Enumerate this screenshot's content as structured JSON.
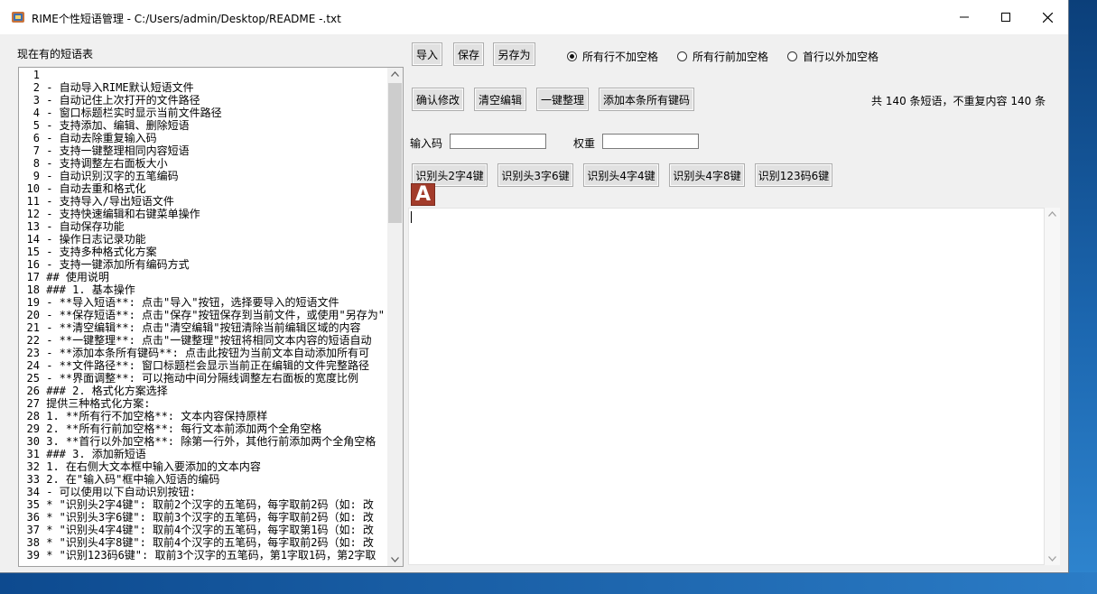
{
  "window": {
    "title": "RIME个性短语管理 - C:/Users/admin/Desktop/README -.txt"
  },
  "left_panel": {
    "label": "现在有的短语表",
    "lines": [
      {
        "n": "1",
        "t": ""
      },
      {
        "n": "2",
        "t": "- 自动导入RIME默认短语文件"
      },
      {
        "n": "3",
        "t": "- 自动记住上次打开的文件路径"
      },
      {
        "n": "4",
        "t": "- 窗口标题栏实时显示当前文件路径"
      },
      {
        "n": "5",
        "t": "- 支持添加、编辑、删除短语"
      },
      {
        "n": "6",
        "t": "- 自动去除重复输入码"
      },
      {
        "n": "7",
        "t": "- 支持一键整理相同内容短语"
      },
      {
        "n": "8",
        "t": "- 支持调整左右面板大小"
      },
      {
        "n": "9",
        "t": "- 自动识别汉字的五笔编码"
      },
      {
        "n": "10",
        "t": "- 自动去重和格式化"
      },
      {
        "n": "11",
        "t": "- 支持导入/导出短语文件"
      },
      {
        "n": "12",
        "t": "- 支持快速编辑和右键菜单操作"
      },
      {
        "n": "13",
        "t": "- 自动保存功能"
      },
      {
        "n": "14",
        "t": "- 操作日志记录功能"
      },
      {
        "n": "15",
        "t": "- 支持多种格式化方案"
      },
      {
        "n": "16",
        "t": "- 支持一键添加所有编码方式"
      },
      {
        "n": "17",
        "t": "## 使用说明"
      },
      {
        "n": "18",
        "t": "### 1. 基本操作"
      },
      {
        "n": "19",
        "t": "- **导入短语**: 点击\"导入\"按钮，选择要导入的短语文件"
      },
      {
        "n": "20",
        "t": "- **保存短语**: 点击\"保存\"按钮保存到当前文件，或使用\"另存为\""
      },
      {
        "n": "21",
        "t": "- **清空编辑**: 点击\"清空编辑\"按钮清除当前编辑区域的内容"
      },
      {
        "n": "22",
        "t": "- **一键整理**: 点击\"一键整理\"按钮将相同文本内容的短语自动"
      },
      {
        "n": "23",
        "t": "- **添加本条所有键码**: 点击此按钮为当前文本自动添加所有可"
      },
      {
        "n": "24",
        "t": "- **文件路径**: 窗口标题栏会显示当前正在编辑的文件完整路径"
      },
      {
        "n": "25",
        "t": "- **界面调整**: 可以拖动中间分隔线调整左右面板的宽度比例"
      },
      {
        "n": "26",
        "t": "### 2. 格式化方案选择"
      },
      {
        "n": "27",
        "t": "提供三种格式化方案:"
      },
      {
        "n": "28",
        "t": "1. **所有行不加空格**: 文本内容保持原样"
      },
      {
        "n": "29",
        "t": "2. **所有行前加空格**: 每行文本前添加两个全角空格"
      },
      {
        "n": "30",
        "t": "3. **首行以外加空格**: 除第一行外，其他行前添加两个全角空格"
      },
      {
        "n": "31",
        "t": "### 3. 添加新短语"
      },
      {
        "n": "32",
        "t": "1. 在右侧大文本框中输入要添加的文本内容"
      },
      {
        "n": "33",
        "t": "2. 在\"输入码\"框中输入短语的编码"
      },
      {
        "n": "34",
        "t": "- 可以使用以下自动识别按钮:"
      },
      {
        "n": "35",
        "t": "* \"识别头2字4键\": 取前2个汉字的五笔码，每字取前2码（如: 改"
      },
      {
        "n": "36",
        "t": "* \"识别头3字6键\": 取前3个汉字的五笔码，每字取前2码（如: 改"
      },
      {
        "n": "37",
        "t": "* \"识别头4字4键\": 取前4个汉字的五笔码，每字取第1码（如: 改"
      },
      {
        "n": "38",
        "t": "* \"识别头4字8键\": 取前4个汉字的五笔码，每字取前2码（如: 改"
      },
      {
        "n": "39",
        "t": "* \"识别123码6键\": 取前3个汉字的五笔码，第1字取1码，第2字取"
      }
    ]
  },
  "toolbar": {
    "import": "导入",
    "save": "保存",
    "save_as": "另存为",
    "radio_options": [
      "所有行不加空格",
      "所有行前加空格",
      "首行以外加空格"
    ],
    "selected_radio": "所有行不加空格"
  },
  "actions": {
    "confirm": "确认修改",
    "clear": "清空编辑",
    "organize": "一键整理",
    "add_all": "添加本条所有键码",
    "stats": "共 140 条短语，不重复内容 140 条"
  },
  "fields": {
    "code_label": "输入码",
    "code_value": "",
    "weight_label": "权重",
    "weight_value": ""
  },
  "recognize": {
    "b1": "识别头2字4键",
    "b2": "识别头3字6键",
    "b3": "识别头4字4键",
    "b4": "识别头4字8键",
    "b5": "识别123码6键"
  },
  "logo": {
    "letter": "A"
  },
  "colors": {
    "logo_bg": "#a33c2b",
    "window_bg": "#f0f0f0"
  }
}
